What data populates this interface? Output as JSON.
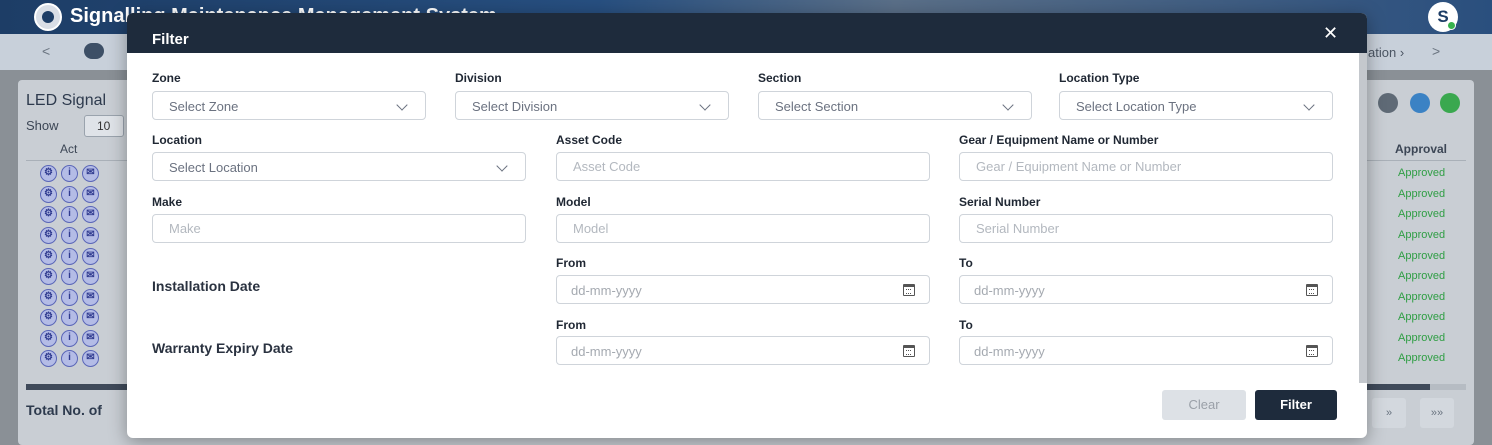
{
  "app": {
    "title": "Signalling Maintenance Management System",
    "user_initial": "S",
    "nav_location": "ation",
    "nav_prev": "<",
    "nav_next": ">"
  },
  "background": {
    "panel_title": "LED Signal",
    "show_label": "Show",
    "show_value": "10",
    "action_col": "Act",
    "approval_col": "Approval",
    "row_status": "Approved",
    "total_label": "Total No. of",
    "pager": [
      "»",
      "»»"
    ]
  },
  "modal": {
    "title": "Filter",
    "close": "✕",
    "zone": {
      "label": "Zone",
      "value": "Select Zone"
    },
    "division": {
      "label": "Division",
      "value": "Select Division"
    },
    "section": {
      "label": "Section",
      "value": "Select Section"
    },
    "location_type": {
      "label": "Location Type",
      "value": "Select Location Type"
    },
    "location": {
      "label": "Location",
      "value": "Select Location"
    },
    "asset_code": {
      "label": "Asset Code",
      "placeholder": "Asset Code"
    },
    "gear": {
      "label": "Gear / Equipment Name or Number",
      "placeholder": "Gear / Equipment Name or Number"
    },
    "make": {
      "label": "Make",
      "placeholder": "Make"
    },
    "model": {
      "label": "Model",
      "placeholder": "Model"
    },
    "serial": {
      "label": "Serial Number",
      "placeholder": "Serial Number"
    },
    "installation": {
      "label": "Installation Date",
      "from_label": "From",
      "from_placeholder": "dd-mm-yyyy",
      "to_label": "To",
      "to_placeholder": "dd-mm-yyyy"
    },
    "warranty": {
      "label": "Warranty Expiry Date",
      "from_label": "From",
      "from_placeholder": "dd-mm-yyyy",
      "to_label": "To",
      "to_placeholder": "dd-mm-yyyy"
    },
    "clear_label": "Clear",
    "filter_label": "Filter"
  },
  "colors": {
    "header_dark": "#1e2b3c",
    "approved_green": "#2f9e44"
  }
}
